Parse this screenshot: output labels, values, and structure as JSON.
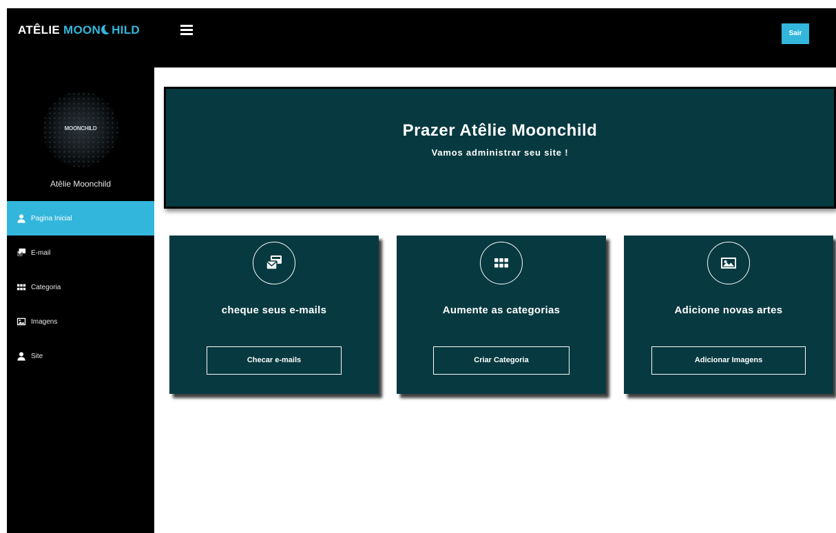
{
  "header": {
    "brand_left": "ATÊLIE ",
    "brand_mid": "MOON",
    "brand_right": "HILD",
    "menu_icon": "hamburger-icon",
    "logout_label": "Sair",
    "accent_color": "#33b6dc"
  },
  "sidebar": {
    "avatar_text": "MOONCHILD",
    "profile_name": "Atêlie Moonchild",
    "items": [
      {
        "label": "Pagina Inicial",
        "icon": "user-icon",
        "active": true
      },
      {
        "label": "E-mail",
        "icon": "mail-icon",
        "active": false
      },
      {
        "label": "Categoria",
        "icon": "grid-icon",
        "active": false
      },
      {
        "label": "Imagens",
        "icon": "image-icon",
        "active": false
      },
      {
        "label": "Site",
        "icon": "user-icon",
        "active": false
      }
    ]
  },
  "banner": {
    "title": "Prazer Atêlie Moonchild",
    "subtitle": "Vamos administrar seu site !"
  },
  "cards": [
    {
      "icon": "mail-icon",
      "title": "cheque seus e-mails",
      "button": "Checar e-mails"
    },
    {
      "icon": "grid-icon",
      "title": "Aumente as categorias",
      "button": "Criar Categoria"
    },
    {
      "icon": "image-icon",
      "title": "Adicione novas artes",
      "button": "Adicionar Imagens"
    }
  ],
  "colors": {
    "panel": "#073940",
    "sidebar": "#000000",
    "accent": "#33b6dc"
  }
}
